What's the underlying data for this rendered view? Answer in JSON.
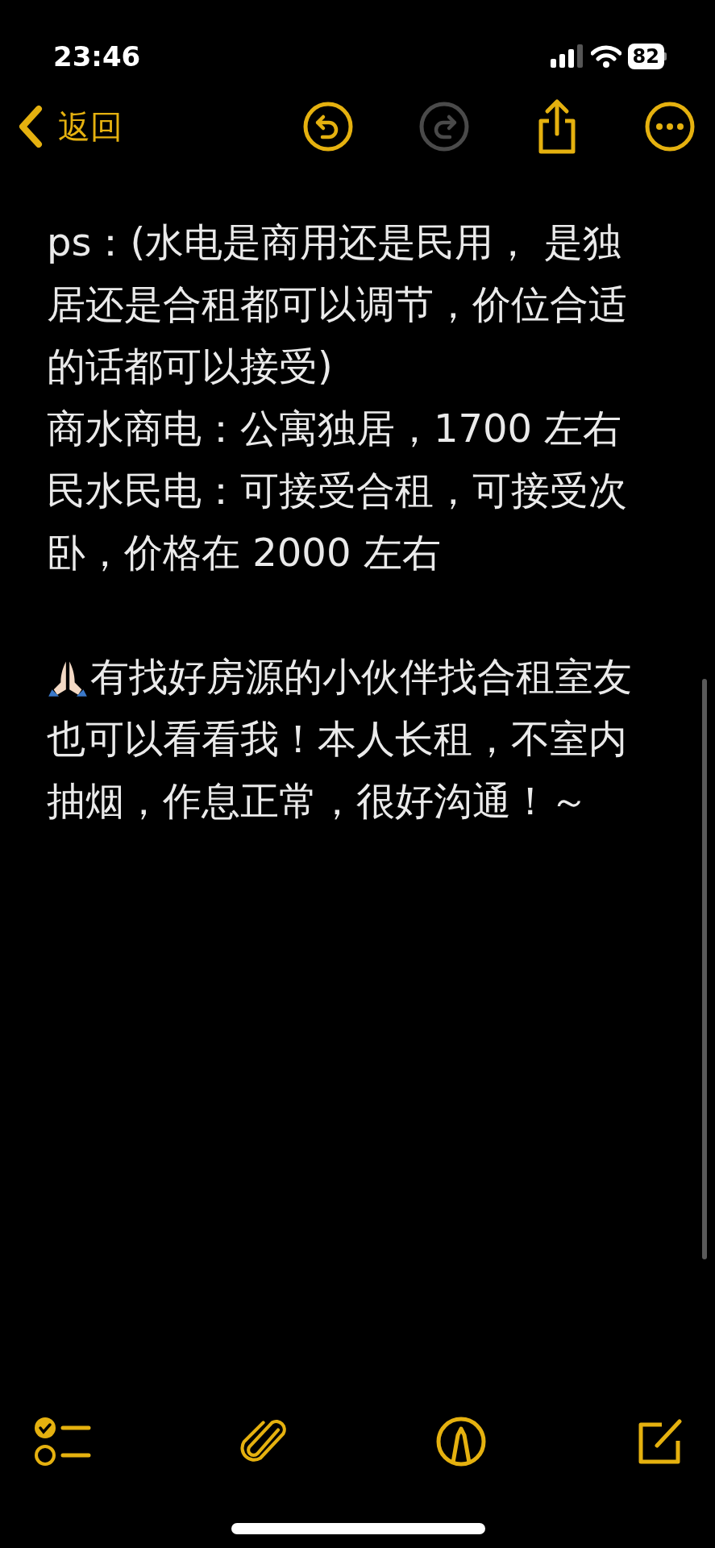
{
  "status_bar": {
    "time": "23:46",
    "battery": "82"
  },
  "nav": {
    "back_label": "返回",
    "undo": {
      "disabled": false
    },
    "redo": {
      "disabled": true
    }
  },
  "note": {
    "paragraphs": [
      {
        "lines": [
          "ps：(水电是商用还是民用， 是独",
          "居还是合租都可以调节，价位合适",
          "的话都可以接受)",
          "商水商电：公寓独居，1700 左右",
          "民水民电：可接受合租，可接受次",
          "卧，价格在 2000 左右"
        ]
      },
      {
        "emoji": true,
        "lines": [
          "有找好房源的小伙伴找合租室友",
          "也可以看看我！本人长租，不室内",
          "抽烟，作息正常，很好沟通！～"
        ]
      }
    ]
  }
}
